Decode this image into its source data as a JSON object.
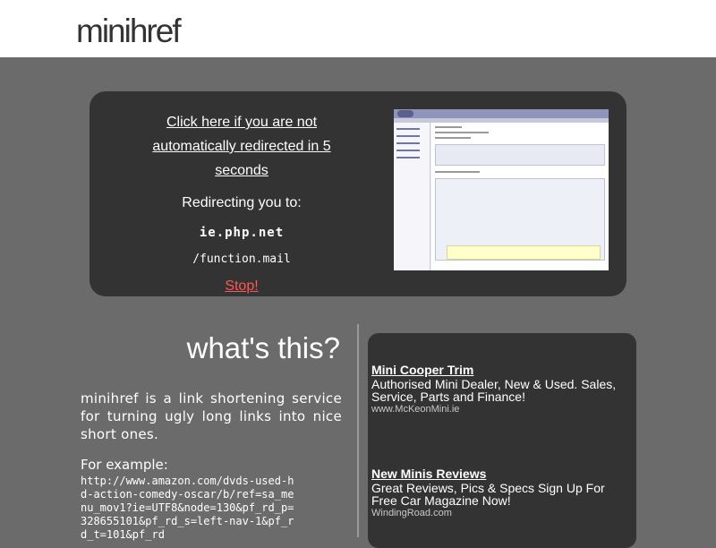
{
  "header": {
    "logo": "minihref"
  },
  "redirect": {
    "click_link": "Click here if you are not automatically redirected in 5 seconds",
    "redirecting_label": "Redirecting you to:",
    "target_host": "ie.php.net",
    "target_path": "/function.mail",
    "stop_link": "Stop!"
  },
  "about": {
    "title": "what's this?",
    "description": "minihref is a link shortening service for turning ugly long links into nice short ones.",
    "example_label": "For example:",
    "example_url": "http://www.amazon.com/dvds-used-hd-action-comedy-oscar/b/ref=sa_menu_mov1?ie=UTF8&node=130&pf_rd_p=328655101&pf_rd_s=left-nav-1&pf_rd_t=101&pf_rd"
  },
  "ads": [
    {
      "title": "Mini Cooper Trim",
      "text": "Authorised Mini Dealer, New & Used. Sales, Service, Parts and Finance!",
      "url": "www.McKeonMini.ie"
    },
    {
      "title": "New Minis Reviews",
      "text": "Great Reviews, Pics & Specs Sign Up For Free Car Magazine Now!",
      "url": "WindingRoad.com"
    }
  ]
}
